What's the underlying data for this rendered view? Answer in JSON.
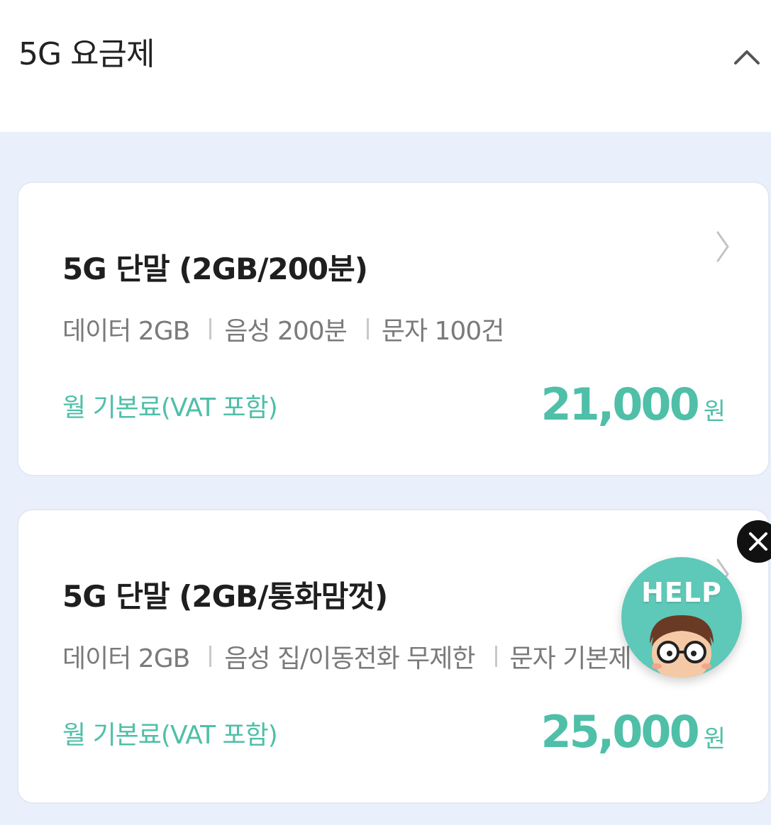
{
  "header": {
    "title": "5G 요금제"
  },
  "plans": [
    {
      "title": "5G 단말 (2GB/200분)",
      "specs": [
        "데이터 2GB",
        "음성 200분",
        "문자 100건"
      ],
      "price_label": "월 기본료(VAT 포함)",
      "price": "21,000",
      "unit": "원"
    },
    {
      "title": "5G 단말 (2GB/통화맘껏)",
      "specs": [
        "데이터 2GB",
        "음성 집/이동전화 무제한",
        "문자 기본제"
      ],
      "price_label": "월 기본료(VAT 포함)",
      "price": "25,000",
      "unit": "원"
    }
  ],
  "help": {
    "label": "HELP"
  },
  "colors": {
    "accent": "#4fbfa8",
    "background": "#eaf0fb",
    "help_bubble": "#5ec8b9"
  },
  "icons": {
    "collapse": "chevron-up-icon",
    "card_arrow": "chevron-right-icon",
    "close": "close-icon"
  }
}
